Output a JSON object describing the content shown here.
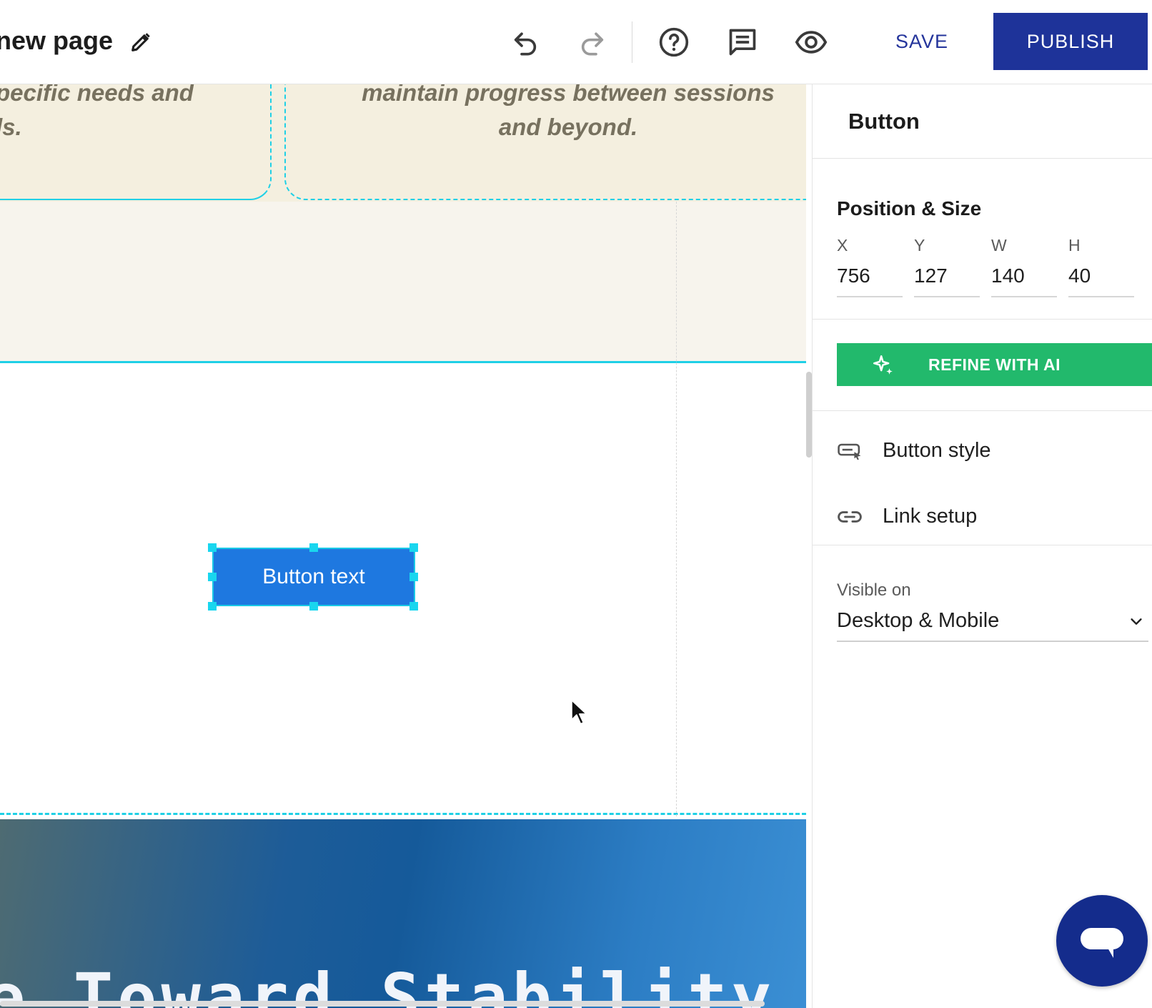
{
  "header": {
    "page_title": "new page",
    "save_label": "SAVE",
    "publish_label": "PUBLISH",
    "icons": [
      "edit-pencil-icon",
      "undo-icon",
      "redo-icon",
      "help-icon",
      "comments-icon",
      "preview-eye-icon"
    ]
  },
  "canvas": {
    "card_left_lines": [
      "pecific needs and",
      "ls."
    ],
    "card_right_lines": [
      "maintain progress between sessions",
      "and beyond."
    ],
    "selected_button_text": "Button text",
    "hero_heading": "e Toward Stability"
  },
  "panel": {
    "title": "Button",
    "position_size": {
      "title": "Position & Size",
      "fields": [
        {
          "label": "X",
          "value": "756"
        },
        {
          "label": "Y",
          "value": "127"
        },
        {
          "label": "W",
          "value": "140"
        },
        {
          "label": "H",
          "value": "40"
        }
      ]
    },
    "refine_label": "REFINE WITH AI",
    "button_style_label": "Button style",
    "link_setup_label": "Link setup",
    "visible_on": {
      "label": "Visible on",
      "value": "Desktop & Mobile"
    }
  },
  "colors": {
    "publish_bg": "#1e3399",
    "save_text": "#24349b",
    "refine_bg": "#22b96c",
    "selected_button_bg": "#1e78e0",
    "selection_outline": "#19d6ef",
    "chat_bubble": "#142c8c"
  }
}
